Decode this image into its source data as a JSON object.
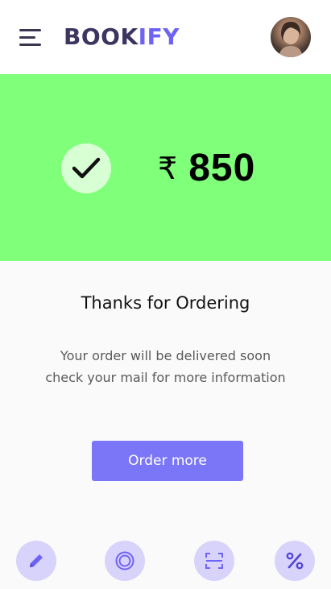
{
  "header": {
    "logo_part1": "BOOK",
    "logo_part2": "IFY",
    "menu_icon": "hamburger-menu-icon",
    "avatar_icon": "user-avatar"
  },
  "banner": {
    "background_color": "#80ff7a",
    "status_icon": "checkmark-icon",
    "currency_symbol": "₹",
    "amount": "850"
  },
  "main": {
    "title": "Thanks for Ordering",
    "message_line1": "Your order will be delivered soon",
    "message_line2": "check your mail for more information",
    "order_button_label": "Order more",
    "accent_color": "#7a76f7"
  },
  "bottom_nav": {
    "items": [
      {
        "icon": "pencil-icon"
      },
      {
        "icon": "target-icon"
      },
      {
        "icon": "scan-icon"
      },
      {
        "icon": "percent-icon"
      }
    ]
  }
}
